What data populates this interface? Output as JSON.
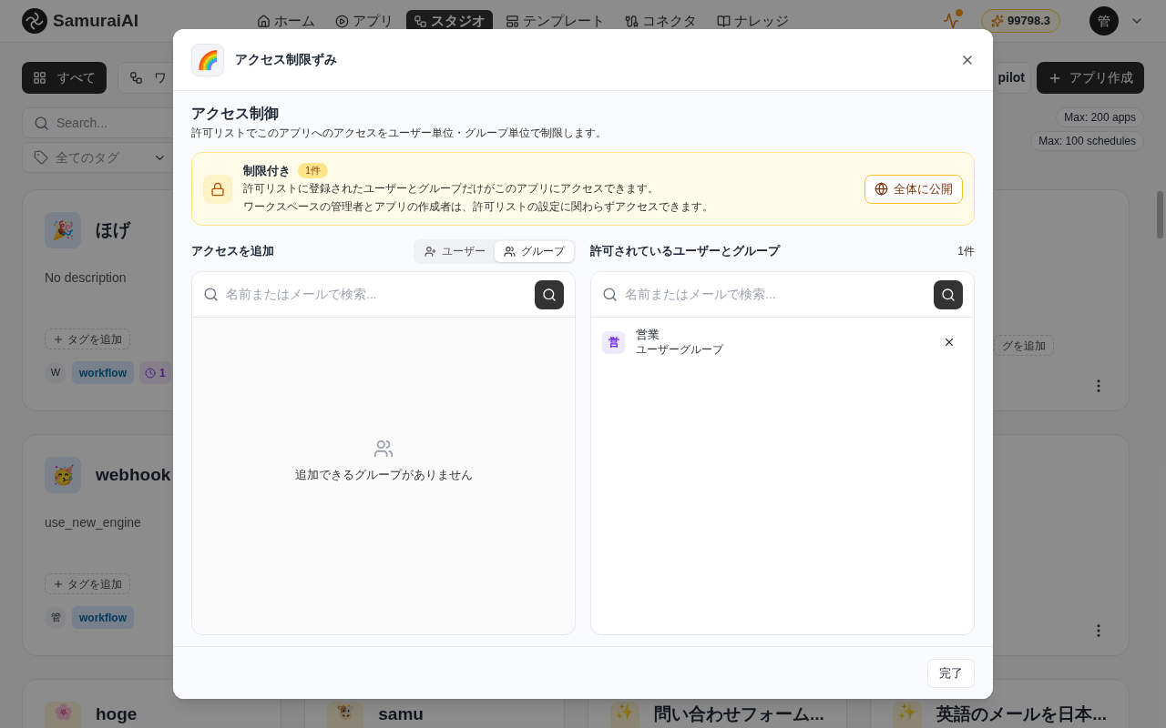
{
  "header": {
    "logo": "SamuraiAI",
    "credits": "99798.3",
    "avatar": "管",
    "notification": true,
    "nav": [
      {
        "label": "ホーム",
        "selected": false
      },
      {
        "label": "アプリ",
        "selected": false
      },
      {
        "label": "スタジオ",
        "selected": true
      },
      {
        "label": "テンプレート",
        "selected": false
      },
      {
        "label": "コネクタ",
        "selected": false
      },
      {
        "label": "ナレッジ",
        "selected": false
      }
    ]
  },
  "toolbar": {
    "filters": [
      {
        "label": "すべて",
        "selected": true
      },
      {
        "label": "ワ",
        "selected": false
      }
    ],
    "search": {
      "placeholder": "Search..."
    },
    "tag_filter": "全てのタグ",
    "copilot": "pilot",
    "create": "アプリ作成",
    "limits": [
      "Max: 200 apps",
      "Max: 100 schedules"
    ]
  },
  "cards": [
    {
      "emoji": "🎉",
      "name": "ほげ",
      "description": "No description",
      "add_tag": "タグを追加",
      "owner": "W",
      "type": "workflow",
      "schedule": "1"
    },
    {
      "emoji": "🥳",
      "name": "webhook",
      "description": "use_new_engine",
      "add_tag": "タグを追加",
      "owner": "管",
      "type": "workflow"
    }
  ],
  "right_cards": [
    {
      "add_tag": "グを追加"
    }
  ],
  "bottom_cards": [
    {
      "emoji": "🌸",
      "name": "hoge"
    },
    {
      "emoji": "🐮",
      "name": "samu"
    },
    {
      "emoji": "✨",
      "name": "問い合わせフォーム..."
    },
    {
      "emoji": "✨",
      "name": "英語のメールを日本..."
    }
  ],
  "modal": {
    "emoji": "🌈",
    "title": "アクセス制限ずみ",
    "heading": "アクセス制御",
    "subtitle": "許可リストでこのアプリへのアクセスをユーザー単位・グループ単位で制限します。",
    "banner": {
      "title": "制限付き",
      "count": "1件",
      "lines": [
        "許可リストに登録されたユーザーとグループだけがこのアプリにアクセスできます。",
        "ワークスペースの管理者とアプリの作成者は、許可リストの設定に関わらずアクセスできます。"
      ],
      "button": "全体に公開"
    },
    "add": {
      "title": "アクセスを追加",
      "tabs": [
        {
          "label": "ユーザー",
          "selected": false
        },
        {
          "label": "グループ",
          "selected": true
        }
      ],
      "placeholder": "名前またはメールで検索...",
      "empty": "追加できるグループがありません"
    },
    "allowed": {
      "title": "許可されているユーザーとグループ",
      "count": "1件",
      "placeholder": "名前またはメールで検索...",
      "items": [
        {
          "badge": "営",
          "name": "営業",
          "type": "ユーザーグループ"
        }
      ]
    },
    "done": "完了"
  }
}
